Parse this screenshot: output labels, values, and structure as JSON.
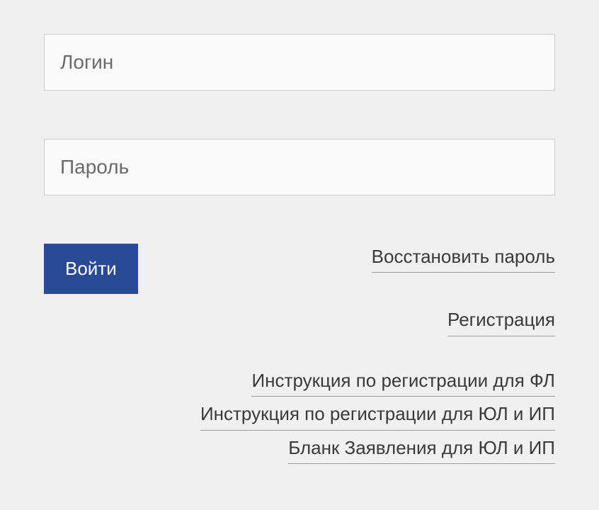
{
  "form": {
    "login_placeholder": "Логин",
    "password_placeholder": "Пароль",
    "submit_label": "Войти"
  },
  "links": {
    "recover_password": "Восстановить пароль",
    "register": "Регистрация",
    "instruction_fl": "Инструкция по регистрации для ФЛ",
    "instruction_ul_ip": "Инструкция по регистрации для ЮЛ и ИП",
    "application_form_ul_ip": "Бланк Заявления для ЮЛ и ИП"
  },
  "colors": {
    "button_bg": "#2a4994",
    "page_bg": "#f0f0f0",
    "input_bg": "#fafafa",
    "input_border": "#cccccc"
  }
}
